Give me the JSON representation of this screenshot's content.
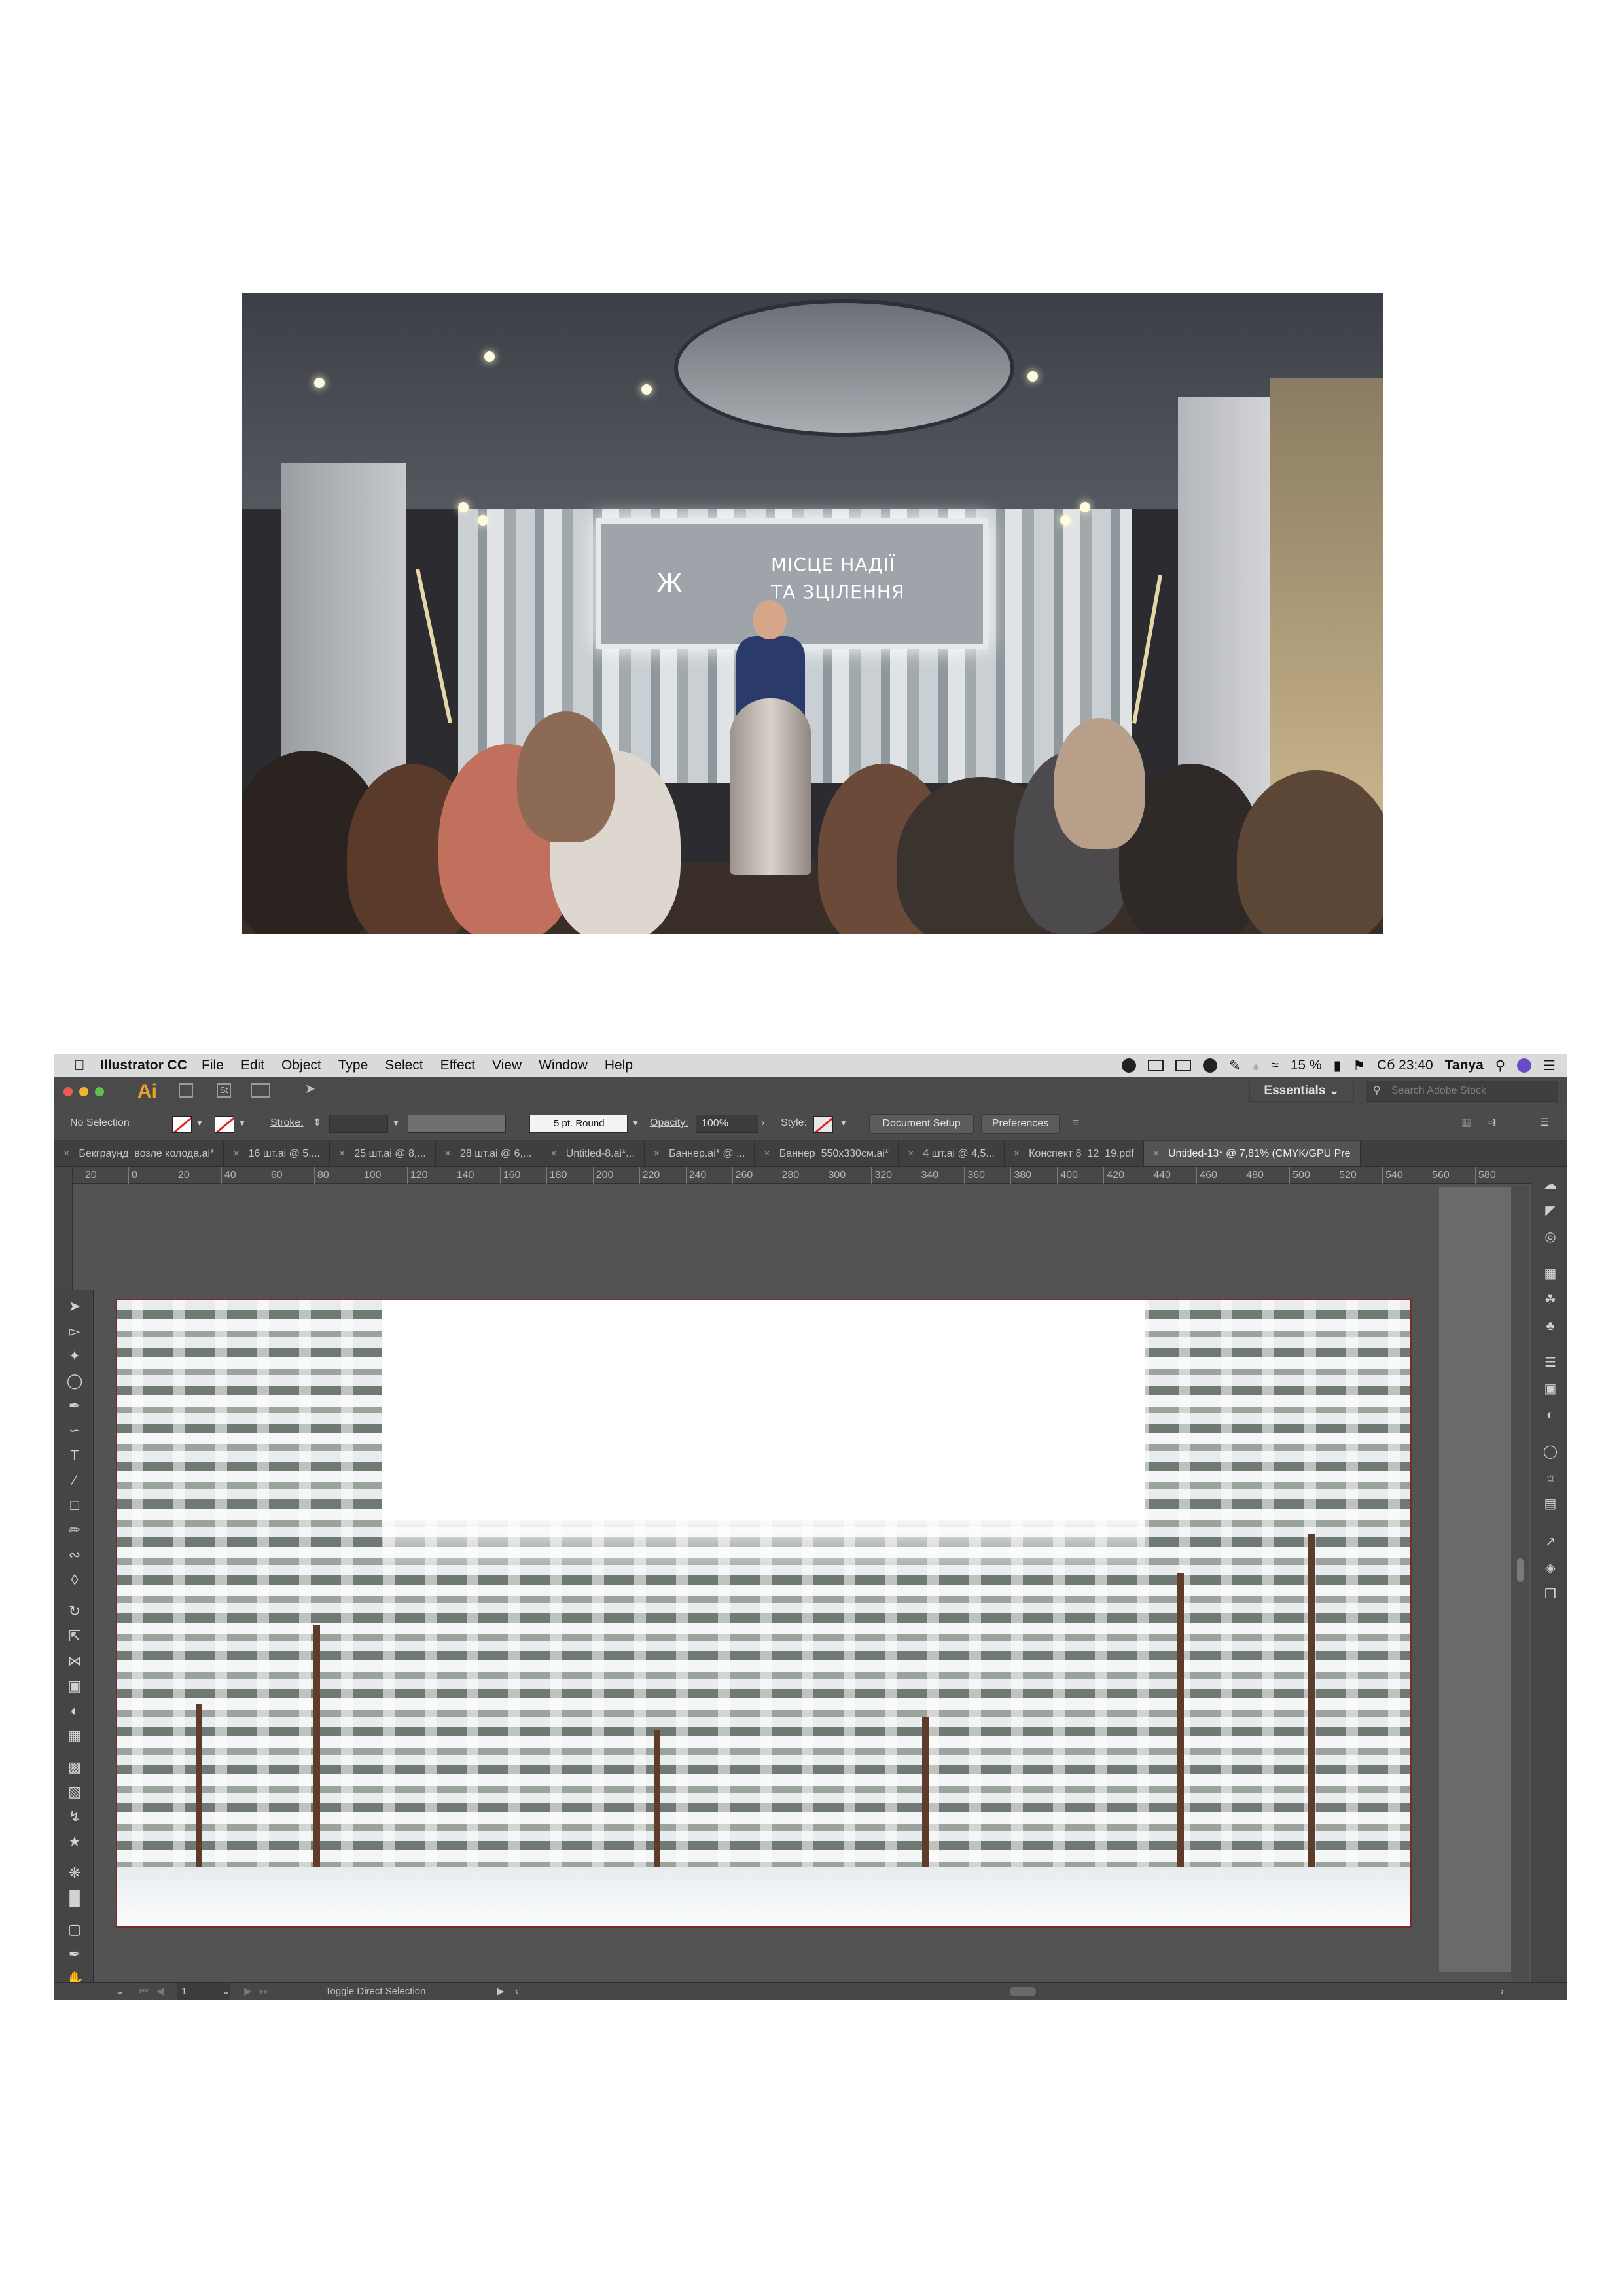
{
  "photo": {
    "screen_logo": "Ж",
    "screen_lines": [
      "МІСЦЕ НАДІЇ",
      "ТА ЗЦІЛЕННЯ"
    ]
  },
  "menubar": {
    "apple_icon": "apple-icon",
    "app_name": "Illustrator CC",
    "items": [
      "File",
      "Edit",
      "Object",
      "Type",
      "Select",
      "Effect",
      "View",
      "Window",
      "Help"
    ],
    "battery": "15 %",
    "clock": "Сб 23:40",
    "user": "Tanya"
  },
  "appbar": {
    "logo": "Ai",
    "workspace": "Essentials",
    "search_placeholder": "Search Adobe Stock"
  },
  "controlbar": {
    "selection": "No Selection",
    "stroke_label": "Stroke:",
    "brush": "5 pt. Round",
    "opacity_label": "Opacity:",
    "opacity_value": "100%",
    "style_label": "Style:",
    "document_setup": "Document Setup",
    "preferences": "Preferences"
  },
  "tabs": [
    "Бекграунд_возле колода.ai*",
    "16 шт.ai @ 5,...",
    "25 шт.ai @ 8,...",
    "28 шт.ai @ 6,...",
    "Untitled-8.ai*...",
    "Баннер.ai* @ ...",
    "Баннер_550x330см.ai*",
    "4 шт.ai @ 4,5...",
    "Конспект 8_12_19.pdf",
    "Untitled-13* @ 7,81% (CMYK/GPU Pre"
  ],
  "ruler_ticks": [
    "20",
    "0",
    "20",
    "40",
    "60",
    "80",
    "100",
    "120",
    "140",
    "160",
    "180",
    "200",
    "220",
    "240",
    "260",
    "280",
    "300",
    "320",
    "340",
    "360",
    "380",
    "400",
    "420",
    "440",
    "460",
    "480",
    "500",
    "520",
    "540",
    "560",
    "580"
  ],
  "statusbar": {
    "page": "1",
    "toggle_label": "Toggle Direct Selection"
  },
  "colors": {
    "ai_orange": "#e8a030",
    "artboard_border": "#7a2a2a",
    "ui_dark": "#535353"
  }
}
